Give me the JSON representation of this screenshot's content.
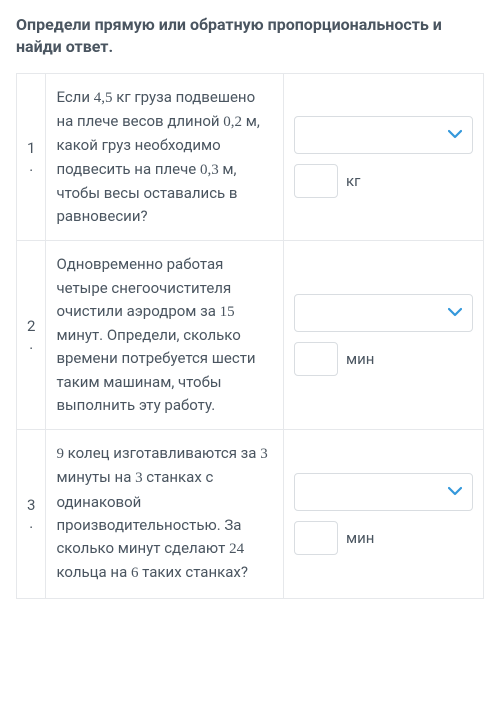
{
  "heading": "Определи прямую или обратную пропорциональность и найди ответ.",
  "questions": [
    {
      "num": "1",
      "t1": "Если ",
      "v1": "4,5",
      "t2": " кг груза подвешено на плече весов длиной ",
      "v2": "0,2",
      "t3": " м, какой груз необходимо подвесить на плече ",
      "v3": "0,3",
      "t4": " м, чтобы весы оставались в равновесии?",
      "unit": "кг",
      "value": ""
    },
    {
      "num": "2",
      "t1": "Одновременно работая четыре снегоочистителя очистили аэродром за ",
      "v1": "15",
      "t2": " минут. Определи, сколько времени потребуется шести таким машинам, чтобы выполнить эту работу.",
      "unit": "мин",
      "value": ""
    },
    {
      "num": "3",
      "v0": "9",
      "t1": " колец изготавливаются за ",
      "v1": "3",
      "t2": " минуты на ",
      "v2": "3",
      "t3": " станках с одинаковой производительностью. За сколько минут сделают ",
      "v3": "24",
      "t4": " кольца на ",
      "v4": "6",
      "t5": " таких станках?",
      "unit": "мин",
      "value": ""
    }
  ]
}
